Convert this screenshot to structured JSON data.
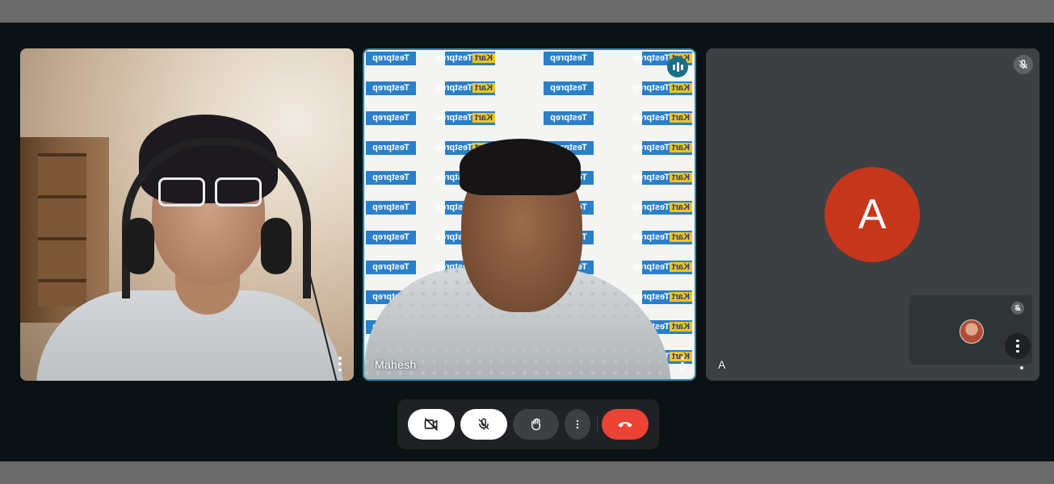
{
  "participants": [
    {
      "name": "",
      "speaking": false
    },
    {
      "name": "Mahesh",
      "speaking": true
    },
    {
      "name": "A",
      "avatar_letter": "A",
      "avatar_color": "#c5361b",
      "muted": true
    }
  ],
  "background_logo": {
    "part1": "Testprep",
    "part2": "Kart"
  },
  "controls": {
    "camera": "camera-off",
    "mic": "mic-off",
    "raise_hand": "raise-hand",
    "more": "more-options",
    "end_call": "end-call"
  },
  "colors": {
    "end_call": "#ea4335",
    "speaking_indicator": "#1a6f86",
    "avatar": "#c5361b"
  }
}
